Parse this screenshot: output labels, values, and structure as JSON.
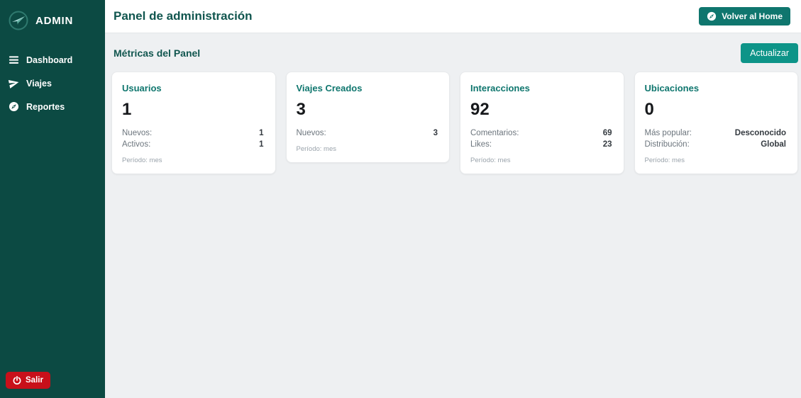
{
  "sidebar": {
    "logo_text": "ADMIN",
    "items": [
      {
        "label": "Dashboard",
        "icon": "bars-icon"
      },
      {
        "label": "Viajes",
        "icon": "paper-plane-icon"
      },
      {
        "label": "Reportes",
        "icon": "compass-icon"
      }
    ],
    "logout_label": "Salir"
  },
  "header": {
    "title": "Panel de administración",
    "home_button_label": "Volver al Home"
  },
  "metrics": {
    "title": "Métricas del Panel",
    "refresh_label": "Actualizar",
    "cards": [
      {
        "title": "Usuarios",
        "value": "1",
        "rows": [
          {
            "label": "Nuevos:",
            "value": "1"
          },
          {
            "label": "Activos:",
            "value": "1"
          }
        ],
        "period": "Período: mes"
      },
      {
        "title": "Viajes Creados",
        "value": "3",
        "rows": [
          {
            "label": "Nuevos:",
            "value": "3"
          }
        ],
        "period": "Período: mes"
      },
      {
        "title": "Interacciones",
        "value": "92",
        "rows": [
          {
            "label": "Comentarios:",
            "value": "69"
          },
          {
            "label": "Likes:",
            "value": "23"
          }
        ],
        "period": "Período: mes"
      },
      {
        "title": "Ubicaciones",
        "value": "0",
        "rows": [
          {
            "label": "Más popular:",
            "value": "Desconocido"
          },
          {
            "label": "Distribución:",
            "value": "Global"
          }
        ],
        "period": "Período: mes"
      }
    ]
  },
  "colors": {
    "sidebar_bg": "#0c4a43",
    "accent_teal": "#0d9488",
    "dark_teal_button": "#0f766e",
    "title_teal": "#11564f",
    "danger_red": "#c8101a",
    "content_bg": "#eef0f2"
  }
}
